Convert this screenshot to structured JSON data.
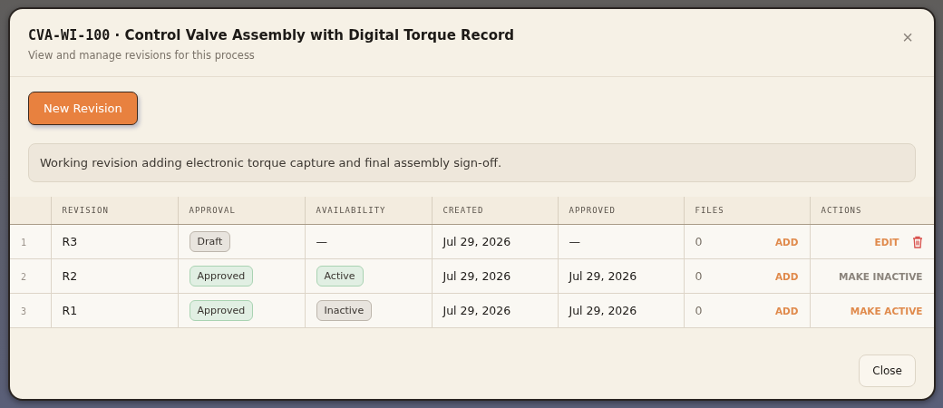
{
  "dialog": {
    "code": "CVA-WI-100",
    "separator": "·",
    "title": "Control Valve Assembly with Digital Torque Record",
    "subtitle": "View and manage revisions for this process",
    "close_icon": "×"
  },
  "new_button": "New Revision",
  "note": "Working revision adding electronic torque capture and final assembly sign-off.",
  "table": {
    "columns": [
      "REVISION",
      "APPROVAL",
      "AVAILABILITY",
      "CREATED",
      "APPROVED",
      "FILES",
      "ACTIONS"
    ],
    "rows": [
      {
        "index": "1",
        "revision": "R3",
        "approval": {
          "label": "Draft",
          "kind": "neutral"
        },
        "availability": {
          "kind": "text",
          "label": "—"
        },
        "created": "Jul 29, 2026",
        "approved": "—",
        "files": "0",
        "add": "ADD",
        "action": {
          "kind": "edit",
          "label": "EDIT"
        }
      },
      {
        "index": "2",
        "revision": "R2",
        "approval": {
          "label": "Approved",
          "kind": "success"
        },
        "availability": {
          "kind": "success",
          "label": "Active"
        },
        "created": "Jul 29, 2026",
        "approved": "Jul 29, 2026",
        "files": "0",
        "add": "ADD",
        "action": {
          "kind": "deactivate",
          "label": "MAKE INACTIVE"
        }
      },
      {
        "index": "3",
        "revision": "R1",
        "approval": {
          "label": "Approved",
          "kind": "success"
        },
        "availability": {
          "kind": "neutral",
          "label": "Inactive"
        },
        "created": "Jul 29, 2026",
        "approved": "Jul 29, 2026",
        "files": "0",
        "add": "ADD",
        "action": {
          "kind": "activate",
          "label": "MAKE ACTIVE"
        }
      }
    ]
  },
  "footer_button": "Close"
}
